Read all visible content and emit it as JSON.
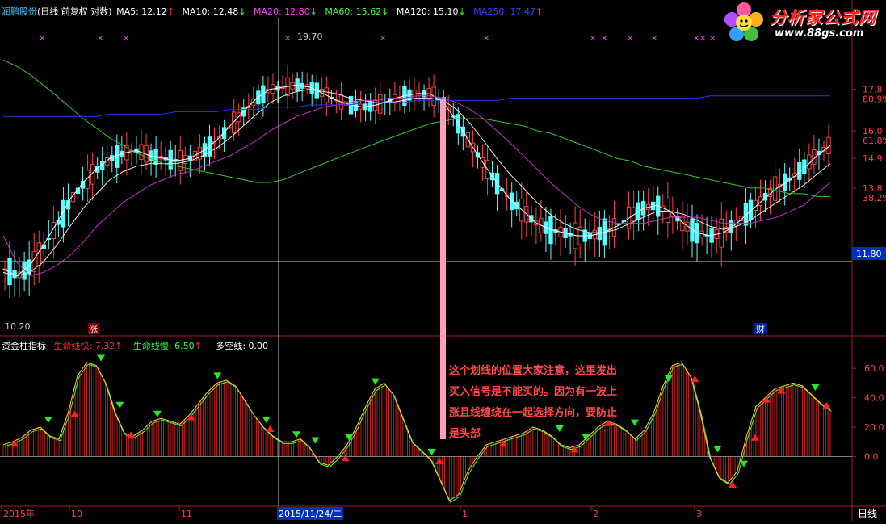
{
  "stock_name": "润鹏股份",
  "chart_mode": "(日线 前复权 对数)",
  "ma_legend": [
    {
      "label": "MA5: 12.12",
      "color": "#ffffff",
      "arrow": "↑",
      "arrow_color": "#ff3030"
    },
    {
      "label": "MA10: 12.48",
      "color": "#ffffff",
      "arrow": "↓",
      "arrow_color": "#3cff3c"
    },
    {
      "label": "MA20: 12.80",
      "color": "#ff40ff",
      "arrow": "↓",
      "arrow_color": "#3cff3c"
    },
    {
      "label": "MA60: 15.62",
      "color": "#3cff3c",
      "arrow": "↓",
      "arrow_color": "#3cff3c"
    },
    {
      "label": "MA120: 15.10",
      "color": "#ffffff",
      "arrow": "↓",
      "arrow_color": "#3cff3c"
    },
    {
      "label": "MA250: 17.47",
      "color": "#3040ff",
      "arrow": "↑",
      "arrow_color": "#ff3030"
    }
  ],
  "watermark": {
    "title": "分析家公式网",
    "url": "www.88gs.com"
  },
  "price_axis": [
    {
      "label": "17.8",
      "pct": "80.9%",
      "value": 17.8
    },
    {
      "label": "16.0",
      "pct": "61.8%",
      "value": 16.0
    },
    {
      "label": "14.9",
      "pct": "",
      "value": 14.9
    },
    {
      "label": "13.8",
      "pct": "38.2%",
      "value": 13.8
    }
  ],
  "cursor_price": "11.80",
  "annotations": {
    "high": "19.70",
    "low": "10.20",
    "event_left": "涨",
    "event_right": "财"
  },
  "indicator": {
    "name": "资金柱指标",
    "fast_label": "生命线快: 7.32",
    "fast_arrow": "↑",
    "slow_label": "生命线慢: 6.50",
    "slow_arrow": "↑",
    "bull_bear_label": "多空线: 0.00",
    "axis_labels": [
      "60.0",
      "40.0",
      "20.0",
      "0.0"
    ],
    "axis_values": [
      60,
      40,
      20,
      0
    ]
  },
  "note": {
    "lines": [
      "这个划线的位置大家注意，这里发出",
      "买入信号是不能买的。因为有一波上",
      "涨且线缠绕在一起选择方向，要防止",
      "是头部"
    ]
  },
  "time_axis": {
    "labels": [
      "2015年",
      "10",
      "11",
      "2015/11/24/二",
      "1",
      "2",
      "3"
    ],
    "period": "日线"
  },
  "chart_data": {
    "type": "line",
    "panels": [
      "price",
      "indicator"
    ],
    "price_y_range": [
      10.2,
      19.7
    ],
    "indicator_y_range": [
      -30,
      70
    ],
    "ma_lines": {
      "ma_fast_white": [
        11.2,
        11.0,
        11.3,
        11.9,
        12.6,
        13.4,
        14.0,
        14.5,
        14.9,
        15.1,
        15.2,
        15.0,
        14.9,
        14.8,
        14.9,
        15.2,
        15.6,
        16.2,
        16.8,
        17.4,
        17.8,
        17.9,
        18.0,
        17.9,
        17.6,
        17.3,
        17.1,
        17.0,
        17.1,
        17.3,
        17.5,
        17.6,
        17.6,
        17.2,
        16.4,
        15.5,
        14.7,
        14.0,
        13.4,
        13.0,
        12.6,
        12.4,
        12.3,
        12.2,
        12.2,
        12.3,
        12.5,
        12.8,
        13.1,
        13.2,
        13.0,
        12.6,
        12.3,
        12.2,
        12.3,
        12.6,
        13.0,
        13.4,
        13.8,
        14.1,
        14.5,
        15.0,
        15.4
      ],
      "ma_slow_white": [
        11.1,
        11.0,
        11.1,
        11.4,
        11.9,
        12.5,
        13.1,
        13.6,
        14.1,
        14.4,
        14.6,
        14.7,
        14.7,
        14.7,
        14.8,
        15.0,
        15.3,
        15.7,
        16.2,
        16.7,
        17.2,
        17.5,
        17.7,
        17.8,
        17.7,
        17.6,
        17.4,
        17.3,
        17.2,
        17.2,
        17.3,
        17.4,
        17.4,
        17.3,
        16.9,
        16.3,
        15.6,
        14.9,
        14.3,
        13.8,
        13.3,
        12.9,
        12.6,
        12.4,
        12.3,
        12.3,
        12.4,
        12.6,
        12.8,
        13.0,
        13.0,
        12.9,
        12.7,
        12.5,
        12.4,
        12.5,
        12.7,
        13.0,
        13.3,
        13.6,
        13.9,
        14.3,
        14.7
      ],
      "ma20": [
        12.2,
        11.4,
        11.0,
        11.1,
        11.3,
        11.6,
        12.0,
        12.5,
        12.9,
        13.3,
        13.6,
        13.9,
        14.1,
        14.3,
        14.4,
        14.6,
        14.8,
        15.0,
        15.3,
        15.6,
        16.0,
        16.3,
        16.6,
        16.8,
        17.0,
        17.1,
        17.2,
        17.3,
        17.3,
        17.4,
        17.4,
        17.5,
        17.5,
        17.4,
        17.2,
        16.9,
        16.5,
        16.0,
        15.5,
        15.0,
        14.5,
        14.0,
        13.6,
        13.2,
        12.9,
        12.7,
        12.6,
        12.6,
        12.6,
        12.7,
        12.8,
        12.8,
        12.8,
        12.7,
        12.6,
        12.6,
        12.6,
        12.7,
        12.8,
        13.0,
        13.2,
        13.6,
        14.0
      ],
      "ma60": [
        19.2,
        18.9,
        18.5,
        18.0,
        17.5,
        17.0,
        16.5,
        16.1,
        15.7,
        15.4,
        15.1,
        14.9,
        14.7,
        14.6,
        14.5,
        14.4,
        14.3,
        14.2,
        14.1,
        14.0,
        14.0,
        14.1,
        14.3,
        14.5,
        14.7,
        14.9,
        15.1,
        15.3,
        15.5,
        15.7,
        15.9,
        16.1,
        16.3,
        16.4,
        16.5,
        16.5,
        16.5,
        16.4,
        16.3,
        16.2,
        16.0,
        15.9,
        15.7,
        15.5,
        15.3,
        15.1,
        14.9,
        14.8,
        14.6,
        14.5,
        14.4,
        14.3,
        14.2,
        14.1,
        14.0,
        13.9,
        13.8,
        13.8,
        13.7,
        13.6,
        13.6,
        13.5,
        13.5
      ],
      "ma250": [
        16.6,
        16.6,
        16.6,
        16.6,
        16.6,
        16.6,
        16.6,
        16.6,
        16.7,
        16.7,
        16.7,
        16.7,
        16.7,
        16.8,
        16.8,
        16.8,
        16.8,
        16.9,
        16.9,
        16.9,
        17.0,
        17.0,
        17.0,
        17.1,
        17.1,
        17.1,
        17.1,
        17.2,
        17.2,
        17.2,
        17.2,
        17.3,
        17.3,
        17.3,
        17.3,
        17.3,
        17.3,
        17.3,
        17.4,
        17.4,
        17.4,
        17.4,
        17.4,
        17.4,
        17.4,
        17.4,
        17.4,
        17.4,
        17.4,
        17.4,
        17.4,
        17.4,
        17.4,
        17.5,
        17.5,
        17.5,
        17.5,
        17.5,
        17.5,
        17.5,
        17.5,
        17.5,
        17.5
      ]
    },
    "indicator_line": [
      8,
      10,
      13,
      18,
      20,
      14,
      12,
      30,
      55,
      64,
      62,
      50,
      30,
      16,
      14,
      18,
      24,
      26,
      24,
      22,
      28,
      36,
      44,
      50,
      52,
      48,
      38,
      28,
      20,
      14,
      10,
      10,
      12,
      6,
      -4,
      -6,
      0,
      8,
      20,
      34,
      46,
      50,
      42,
      26,
      10,
      4,
      -2,
      -16,
      -30,
      -26,
      -10,
      0,
      8,
      10,
      12,
      14,
      16,
      20,
      18,
      14,
      8,
      6,
      8,
      14,
      20,
      24,
      22,
      18,
      12,
      18,
      30,
      48,
      62,
      64,
      54,
      30,
      0,
      -14,
      -18,
      -10,
      14,
      34,
      40,
      46,
      48,
      50,
      48,
      42,
      36,
      32
    ]
  }
}
